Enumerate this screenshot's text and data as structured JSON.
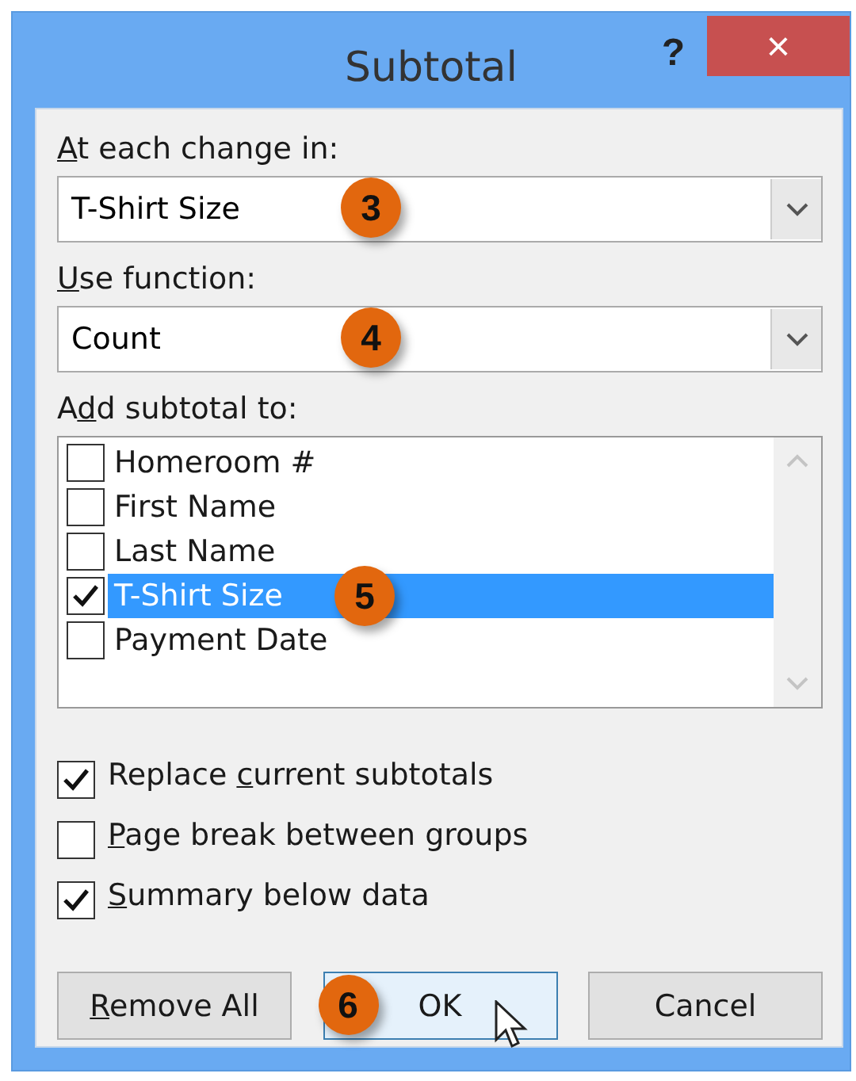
{
  "window": {
    "title": "Subtotal",
    "help": "?",
    "close": "×"
  },
  "change_field": {
    "label_key": "A",
    "label_after": "t each change in:",
    "value": "T-Shirt Size",
    "callout": "3"
  },
  "function_field": {
    "label_key": "U",
    "label_after": "se function:",
    "value": "Count",
    "callout": "4"
  },
  "add_to": {
    "label_before": "A",
    "label_key": "d",
    "label_after": "d subtotal to:",
    "items": [
      {
        "label": "Homeroom #",
        "checked": false,
        "selected": false
      },
      {
        "label": "First Name",
        "checked": false,
        "selected": false
      },
      {
        "label": "Last Name",
        "checked": false,
        "selected": false
      },
      {
        "label": "T-Shirt Size",
        "checked": true,
        "selected": true,
        "callout": "5"
      },
      {
        "label": "Payment Date",
        "checked": false,
        "selected": false
      }
    ]
  },
  "options": [
    {
      "label_before": "Replace ",
      "label_key": "c",
      "label_after": "urrent subtotals",
      "checked": true
    },
    {
      "label_key": "P",
      "label_after": "age break between groups",
      "checked": false
    },
    {
      "label_key": "S",
      "label_after": "ummary below data",
      "checked": true
    }
  ],
  "buttons": [
    {
      "label_key": "R",
      "label_after": "emove All",
      "focused": false
    },
    {
      "label_after": "OK",
      "focused": true,
      "callout": "6"
    },
    {
      "label_after": "Cancel",
      "focused": false
    }
  ]
}
